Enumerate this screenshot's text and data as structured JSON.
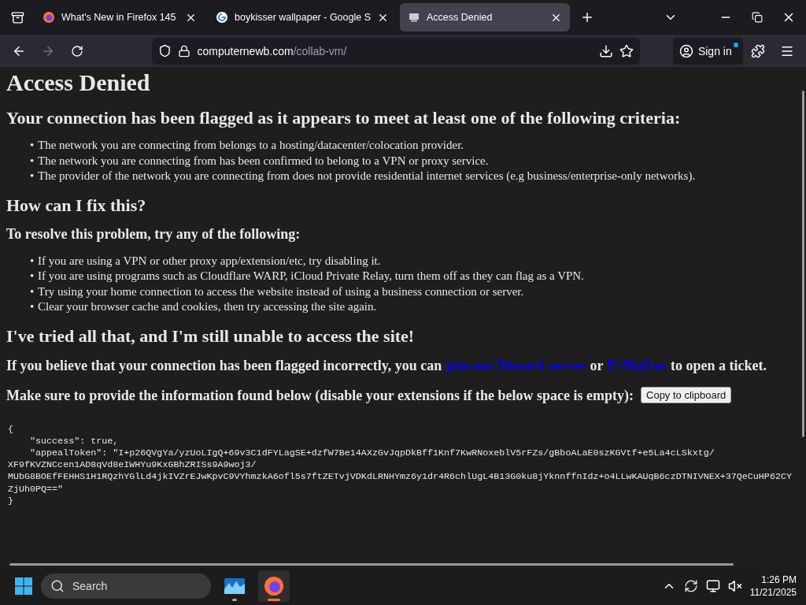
{
  "tabs": [
    {
      "title": "What's New in Firefox 145",
      "kind": "firefox",
      "selected": false
    },
    {
      "title": "boykisser wallpaper - Google S",
      "kind": "google",
      "selected": false
    },
    {
      "title": "Access Denied",
      "kind": "site",
      "selected": true
    }
  ],
  "address": {
    "host": "computernewb.com",
    "path": "/collab-vm/"
  },
  "sign_in": "Sign in",
  "page": {
    "title": "Access Denied",
    "marker": "•",
    "heading": "Your connection has been flagged as it appears to meet at least one of the following criteria:",
    "criteria": [
      "The network you are connecting from belongs to a hosting/datacenter/colocation provider.",
      "The network you are connecting from has been confirmed to belong to a VPN or proxy service.",
      "The provider of the network you are connecting from does not provide residential internet services (e.g business/enterprise-only networks)."
    ],
    "fix_heading": "How can I fix this?",
    "fix_subheading": "To resolve this problem, try any of the following:",
    "fixes": [
      "If you are using a VPN or other proxy app/extension/etc, try disabling it.",
      "If you are using programs such as Cloudflare WARP, iCloud Private Relay, turn them off as they can flag as a VPN.",
      "Try using your home connection to access the website instead of using a business connection or server.",
      "Clear your browser cache and cookies, then try accessing the site again."
    ],
    "still_heading": "I've tried all that, and I'm still unable to access the site!",
    "contact": {
      "before": "If you believe that your connection has been flagged incorrectly, you can",
      "link_1": "join our Discord server",
      "middle": "or",
      "link_2": "E-Mail us",
      "after": "to open a ticket."
    },
    "provide": "Make sure to provide the information found below (disable your extensions if the below space is empty):",
    "copy_button": "Copy to clipboard",
    "code_lines": [
      "{",
      "    \"success\": true,",
      "    \"appealToken\": \"I+p26QVgYa/yzUoLIgQ+69v3C1dFYLagSE+dzfW7Be14AXzGvJqpDkBff1Knf7KwRNoxeblV5rFZs/gBboALaE0szKGVtf+e5La4cLSkxtg/",
      "XF9fKVZNCcen1AD8qVd8eIWHYu9KxGBhZRISs9A9woj3/",
      "MUbG8BOEfFEHHS1H1RQzhYGlLd4jkIVZrEJwKpvC9VYhmzkA6ofl5s7ftZETvjVDKdLRNHYmz6y1dr4R6chlUgL4B13G0ku8jYknnffnIdz+o4LLwKAUqB6czDTNIVNEX+37QeCuHP62CY",
      "ZjUh0PQ==\"",
      "}"
    ]
  },
  "taskbar": {
    "search": "Search",
    "time": "1:26 PM",
    "date": "11/21/2025"
  }
}
